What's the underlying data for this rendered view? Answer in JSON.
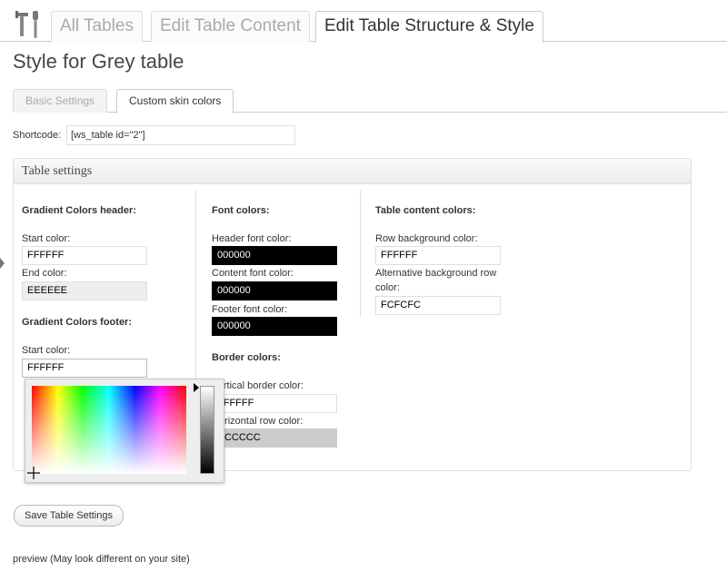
{
  "nav": {
    "tabs": [
      {
        "label": "All Tables"
      },
      {
        "label": "Edit Table Content"
      },
      {
        "label": "Edit Table Structure & Style"
      }
    ]
  },
  "page_title": "Style for Grey table",
  "subtabs": [
    {
      "label": "Basic Settings"
    },
    {
      "label": "Custom skin colors"
    }
  ],
  "shortcode": {
    "label": "Shortcode:",
    "value": "[ws_table id=\"2\"]"
  },
  "settings": {
    "title": "Table settings",
    "gradient_header": {
      "heading": "Gradient Colors header:",
      "start_label": "Start color:",
      "start_value": "FFFFFF",
      "end_label": "End color:",
      "end_value": "EEEEEE"
    },
    "gradient_footer": {
      "heading": "Gradient Colors footer:",
      "start_label": "Start color:",
      "start_value": "FFFFFF"
    },
    "font_colors": {
      "heading": "Font colors:",
      "header_label": "Header font color:",
      "header_value": "000000",
      "content_label": "Content font color:",
      "content_value": "000000",
      "footer_label": "Footer font color:",
      "footer_value": "000000"
    },
    "border_colors": {
      "heading": "Border colors:",
      "vertical_label": "Vertical border color:",
      "vertical_value": "FFFFFF",
      "horizontal_label": "Horizontal row color:",
      "horizontal_value": "CCCCCC"
    },
    "content_colors": {
      "heading": "Table content colors:",
      "row_bg_label": "Row background color:",
      "row_bg_value": "FFFFFF",
      "alt_bg_label_line1": "Alternative background row",
      "alt_bg_label_line2": "color:",
      "alt_bg_value": "FCFCFC"
    }
  },
  "save_button": "Save Table Settings",
  "preview_text": "preview (May look different on your site)",
  "colors": {
    "accent_border": "#cccccc",
    "dark_input": "#000000",
    "grey_input": "#cccccc",
    "light_input": "#eeeeee"
  },
  "icons": [
    "tools-icon",
    "crosshair-icon",
    "slider-arrow-icon"
  ]
}
